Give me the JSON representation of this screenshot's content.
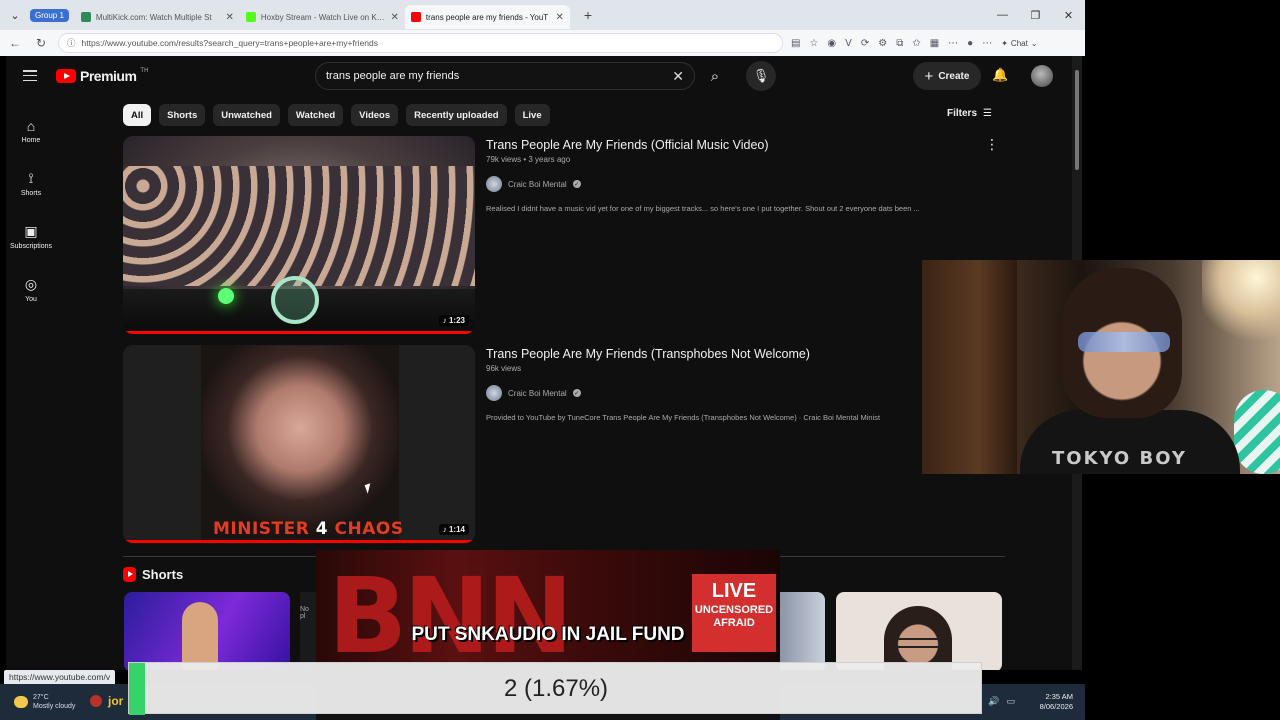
{
  "browser": {
    "tab_group": "Group 1",
    "tabs": [
      {
        "title": "MultiKick.com: Watch Multiple St",
        "favicon_color": "#2e8b57",
        "active": false
      },
      {
        "title": "Hoxby Stream - Watch Live on Kick",
        "favicon_color": "#53fc18",
        "active": false
      },
      {
        "title": "trans people are my friends - YouT",
        "favicon_color": "#ff0000",
        "active": true
      }
    ],
    "url": "https://www.youtube.com/results?search_query=trans+people+are+my+friends",
    "chat_label": "Chat"
  },
  "youtube": {
    "brand": "Premium",
    "brand_mark": "TH",
    "search": {
      "query": "trans people are my friends"
    },
    "create_label": "Create",
    "sidebar": [
      {
        "label": "Home",
        "icon": "home-icon",
        "glyph": "⌂"
      },
      {
        "label": "Shorts",
        "icon": "shorts-icon",
        "glyph": "⟟"
      },
      {
        "label": "Subscriptions",
        "icon": "subscriptions-icon",
        "glyph": "▣"
      },
      {
        "label": "You",
        "icon": "you-icon",
        "glyph": "◎"
      }
    ],
    "chips": [
      "All",
      "Shorts",
      "Unwatched",
      "Watched",
      "Videos",
      "Recently uploaded",
      "Live"
    ],
    "filters_label": "Filters",
    "videos": [
      {
        "title": "Trans People Are My Friends (Official Music Video)",
        "info": "79k views • 3 years ago",
        "channel": "Craic Boi Mental",
        "description": "Realised I didnt have a music vid yet for one of my biggest tracks... so here's one I put together. Shout out 2 everyone dats been ...",
        "duration": "1:23"
      },
      {
        "title": "Trans People Are My Friends (Transphobes Not Welcome)",
        "info": "96k views",
        "channel": "Craic Boi Mental",
        "description": "Provided to YouTube by TuneCore Trans People Are My Friends (Transphobes Not Welcome) · Craic Boi Mental Minist",
        "duration": "1:14",
        "thumb_caption_a": "MINISTER",
        "thumb_caption_b": "4",
        "thumb_caption_c": "CHAOS"
      }
    ],
    "shorts_heading": "Shorts",
    "shorts_fragment": "No\npl"
  },
  "status_url": "https://www.youtube.com/v",
  "taskbar": {
    "temperature": "27°C",
    "weather": "Mostly cloudy",
    "user_fragment": "jor",
    "time": "2:35 AM",
    "date": "8/06/2026"
  },
  "stream_overlay": {
    "bnn_letters": "BNN",
    "live": "LIVE",
    "uncensored": "UNCENSORED",
    "afraid": "AFRAID",
    "banner": "PUT SNKAUDIO IN JAIL FUND",
    "webcam_shirt": "TOKYO BOY"
  },
  "poll": {
    "text": "2 (1.67%)",
    "fraction": 0.0167,
    "color": "#36d36a"
  }
}
